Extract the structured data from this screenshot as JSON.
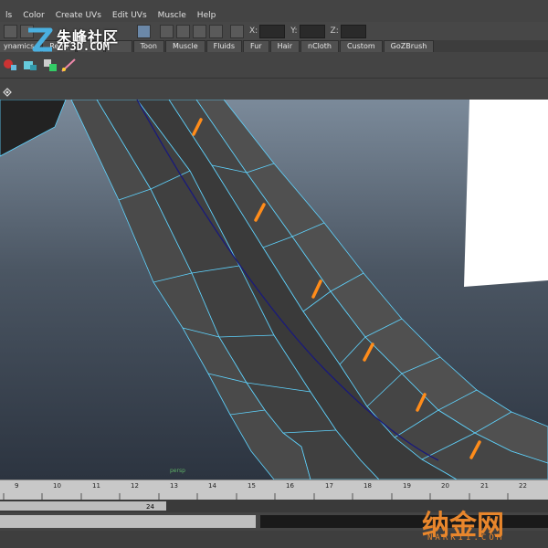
{
  "menubar": {
    "items": [
      "ls",
      "Color",
      "Create UVs",
      "Edit UVs",
      "Muscle",
      "Help"
    ]
  },
  "statusline": {
    "x_label": "X:",
    "y_label": "Y:",
    "z_label": "Z:"
  },
  "shelf": {
    "tabs": [
      "ynamics",
      "Rend",
      "",
      "",
      "Toon",
      "Muscle",
      "Fluids",
      "Fur",
      "Hair",
      "nCloth",
      "Custom",
      "GoZBrush"
    ]
  },
  "viewport": {
    "camera_label": "persp"
  },
  "timeslider": {
    "ticks": [
      "9",
      "10",
      "11",
      "12",
      "13",
      "14",
      "15",
      "16",
      "17",
      "18",
      "19",
      "20",
      "21",
      "22"
    ]
  },
  "rangeslider": {
    "value": "24"
  },
  "watermarks": {
    "top_cn": "朱峰社区",
    "top_en": "ZF3D.COM",
    "bottom_cn": "纳金网",
    "bottom_en": "NARKII.COM"
  },
  "colors": {
    "wire": "#5fd4ff",
    "mesh": "#474747",
    "edge_highlight": "#ff8c1a",
    "curve": "#1a1a7a"
  }
}
